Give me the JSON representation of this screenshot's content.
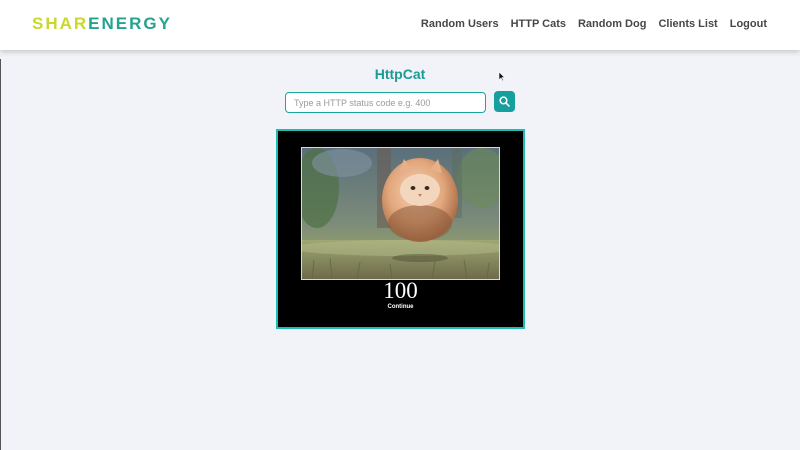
{
  "logo": {
    "part1": "SHAR",
    "part2": "ENERGY"
  },
  "nav": {
    "items": [
      {
        "label": "Random Users"
      },
      {
        "label": "HTTP Cats"
      },
      {
        "label": "Random Dog"
      },
      {
        "label": "Clients List"
      },
      {
        "label": "Logout"
      }
    ]
  },
  "main": {
    "title": "HttpCat",
    "search": {
      "placeholder": "Type a HTTP status code e.g. 400",
      "value": "",
      "button_icon": "search-icon"
    },
    "cat_image": {
      "code": "100",
      "text": "Continue"
    }
  },
  "colors": {
    "accent": "#1b9b94",
    "logo_yellow": "#c8d92c",
    "logo_teal": "#24a38f",
    "frame_border": "#1fbcb6",
    "button_bg": "#15a09d"
  }
}
